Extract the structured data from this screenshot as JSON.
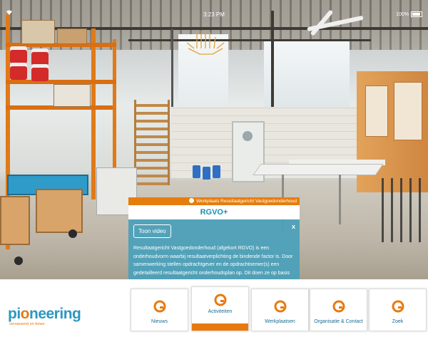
{
  "status_bar": {
    "time": "3:23 PM",
    "battery": "100%"
  },
  "breadcrumb": "Werkplaats Resultaatgericht Vastgoedonderhoud",
  "panel": {
    "title": "RGVO+",
    "video_button": "Toon video",
    "close": "x",
    "body": "Resultaatgericht Vastgoedonderhoud (afgekort RGVO) is een onderhoudvorm waarbij resultaatverplichting de bindende factor is. Door samenwerking stellen opdrachtgever en de opdrachtnemer(s) een gedetailleerd resultaatgericht onderhoudsplan op. Dit doen ze op basis"
  },
  "logo": {
    "word_start": "pi",
    "word_o": "o",
    "word_end": "neering",
    "tagline": "verrassend en bewe"
  },
  "nav": [
    {
      "label": "Nieuws",
      "icon": "orange-ring-icon"
    },
    {
      "label": "Activiteiten",
      "icon": "orange-ring-icon",
      "active": true
    },
    {
      "label": "Werkplaatsen",
      "icon": "orange-ring-icon"
    },
    {
      "label": "Organisatie & Contact",
      "icon": "orange-ring-icon"
    },
    {
      "label": "Zoek",
      "icon": "orange-ring-icon"
    }
  ],
  "colors": {
    "accent": "#e8790f",
    "brand_blue": "#2c97c2",
    "panel": "#4aa0ba"
  }
}
